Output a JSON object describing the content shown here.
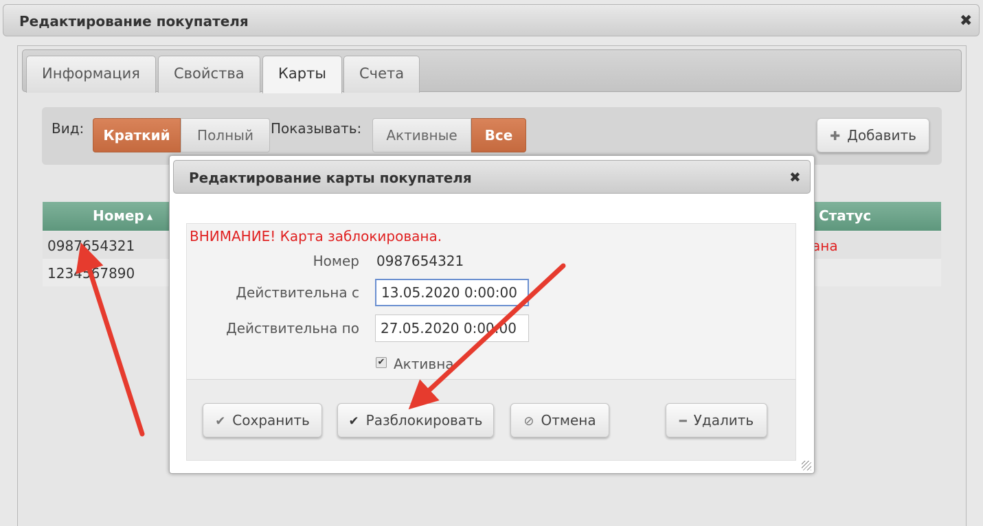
{
  "window": {
    "title": "Редактирование покупателя",
    "close": "✖"
  },
  "tabs": [
    {
      "label": "Информация"
    },
    {
      "label": "Свойства"
    },
    {
      "label": "Карты"
    },
    {
      "label": "Счета"
    }
  ],
  "toolbar": {
    "view_label": "Вид:",
    "view_options": [
      "Краткий",
      "Полный"
    ],
    "show_label": "Показывать:",
    "show_options": [
      "Активные",
      "Все"
    ],
    "add_label": "Добавить",
    "add_icon": "plus-icon"
  },
  "grid": {
    "headers": [
      "Номер",
      "Статус"
    ],
    "sort_indicator": "▲",
    "rows": [
      {
        "number": "0987654321",
        "status": "ана"
      },
      {
        "number": "1234567890",
        "status": ""
      }
    ]
  },
  "dialog": {
    "title": "Редактирование карты покупателя",
    "close": "✖",
    "warning": "ВНИМАНИЕ! Карта заблокирована.",
    "number_label": "Номер",
    "number_value": "0987654321",
    "valid_from_label": "Действительна с",
    "valid_from_value": "13.05.2020 0:00:00",
    "valid_to_label": "Действительна по",
    "valid_to_value": "27.05.2020 0:00:00",
    "active_label": "Активна",
    "active_checked": true,
    "buttons": {
      "save": "Сохранить",
      "unblock": "Разблокировать",
      "cancel": "Отмена",
      "delete": "Удалить"
    }
  },
  "colors": {
    "accent_orange": "#d27a4f",
    "grid_header_green": "#6ea68b",
    "warning_red": "#e02020",
    "annotation_arrow": "#e63b2e"
  }
}
